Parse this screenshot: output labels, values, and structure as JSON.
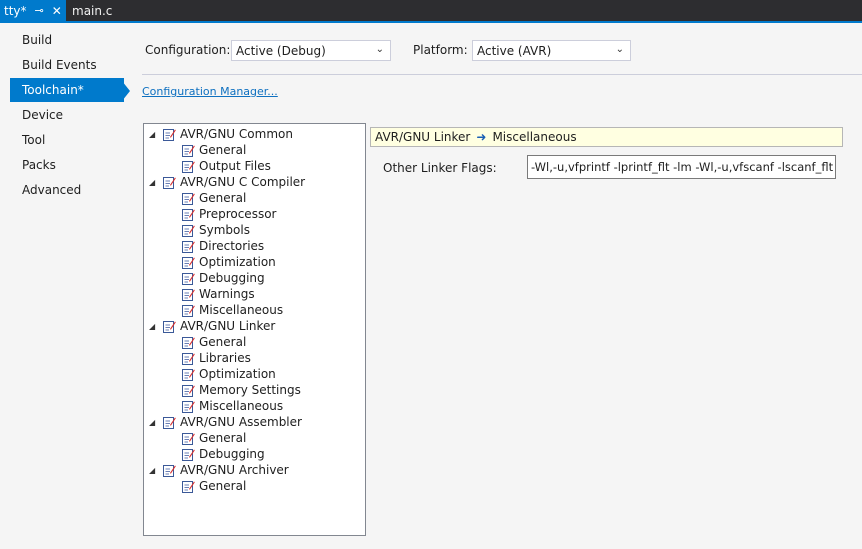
{
  "tabs": {
    "active_tab": "tty*",
    "pin_glyph": "⊸",
    "close_glyph": "✕",
    "second_tab": "main.c"
  },
  "nav": {
    "items": [
      "Build",
      "Build Events",
      "Toolchain*",
      "Device",
      "Tool",
      "Packs",
      "Advanced"
    ],
    "selected_index": 2
  },
  "config": {
    "configuration_label": "Configuration:",
    "configuration_value": "Active (Debug)",
    "platform_label": "Platform:",
    "platform_value": "Active (AVR)",
    "manager_link": "Configuration Manager..."
  },
  "tree": {
    "nodes": [
      {
        "label": "AVR/GNU Common",
        "level": 0
      },
      {
        "label": "General",
        "level": 1
      },
      {
        "label": "Output Files",
        "level": 1
      },
      {
        "label": "AVR/GNU C Compiler",
        "level": 0
      },
      {
        "label": "General",
        "level": 1
      },
      {
        "label": "Preprocessor",
        "level": 1
      },
      {
        "label": "Symbols",
        "level": 1
      },
      {
        "label": "Directories",
        "level": 1
      },
      {
        "label": "Optimization",
        "level": 1
      },
      {
        "label": "Debugging",
        "level": 1
      },
      {
        "label": "Warnings",
        "level": 1
      },
      {
        "label": "Miscellaneous",
        "level": 1
      },
      {
        "label": "AVR/GNU Linker",
        "level": 0
      },
      {
        "label": "General",
        "level": 1
      },
      {
        "label": "Libraries",
        "level": 1
      },
      {
        "label": "Optimization",
        "level": 1
      },
      {
        "label": "Memory Settings",
        "level": 1
      },
      {
        "label": "Miscellaneous",
        "level": 1
      },
      {
        "label": "AVR/GNU Assembler",
        "level": 0
      },
      {
        "label": "General",
        "level": 1
      },
      {
        "label": "Debugging",
        "level": 1
      },
      {
        "label": "AVR/GNU Archiver",
        "level": 0
      },
      {
        "label": "General",
        "level": 1
      }
    ]
  },
  "panel": {
    "crumb_parent": "AVR/GNU Linker",
    "crumb_child": "Miscellaneous",
    "flags_label": "Other Linker Flags:",
    "flags_value": "-Wl,-u,vfprintf -lprintf_flt -lm -Wl,-u,vfscanf -lscanf_flt -lm"
  },
  "colors": {
    "accent": "#007acc",
    "tabstrip": "#2d2d30",
    "crumb_bg": "#ffffe1",
    "link": "#0e70c0"
  }
}
